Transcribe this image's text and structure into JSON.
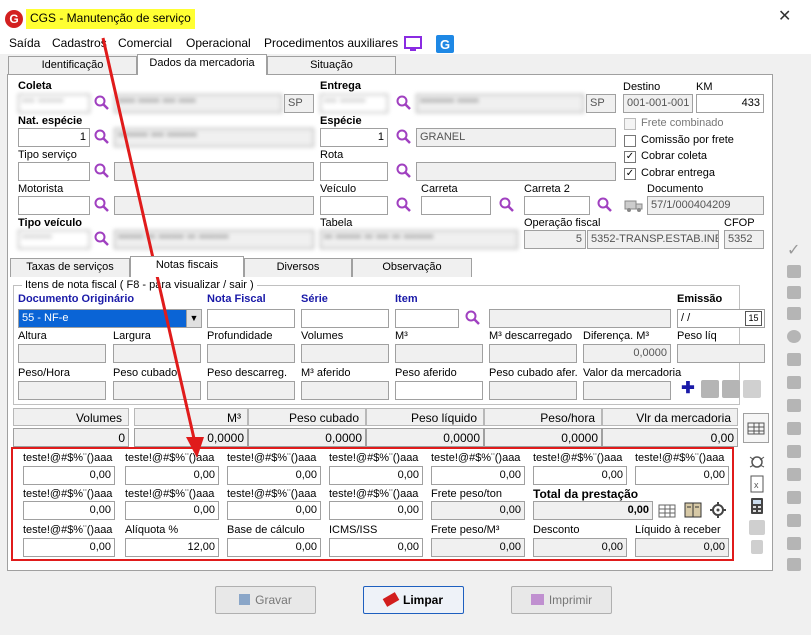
{
  "window": {
    "title": "CGS - Manutenção de serviço",
    "close": "✕"
  },
  "menu": [
    "Saída",
    "Cadastros",
    "Comercial",
    "Operacional",
    "Procedimentos auxiliares"
  ],
  "tabs_top": [
    "Identificação",
    "Dados da mercadoria",
    "Situação"
  ],
  "coleta": {
    "label": "Coleta",
    "code": "*** ******",
    "name": "**** ***** *** ****",
    "uf": "SP"
  },
  "entrega": {
    "label": "Entrega",
    "code": "*** ******",
    "name": "******** *****",
    "uf": "SP"
  },
  "destino": {
    "label": "Destino",
    "value": "001-001-001"
  },
  "km": {
    "label": "KM",
    "value": "433"
  },
  "nat_especie": {
    "label": "Nat. espécie",
    "code": "1",
    "name": "******* *** *******"
  },
  "especie": {
    "label": "Espécie",
    "code": "1",
    "name": "GRANEL"
  },
  "tipo_servico": {
    "label": "Tipo serviço"
  },
  "rota": {
    "label": "Rota"
  },
  "checks": [
    {
      "label": "Frete combinado",
      "checked": false,
      "disabled": true
    },
    {
      "label": "Comissão por frete",
      "checked": false,
      "disabled": false
    },
    {
      "label": "Cobrar coleta",
      "checked": true,
      "disabled": false
    },
    {
      "label": "Cobrar entrega",
      "checked": true,
      "disabled": false
    }
  ],
  "motorista": {
    "label": "Motorista"
  },
  "veiculo": {
    "label": "Veículo"
  },
  "carreta": {
    "label": "Carreta"
  },
  "carreta2": {
    "label": "Carreta 2"
  },
  "documento": {
    "label": "Documento",
    "value": "57/1/000404209"
  },
  "tipo_veiculo": {
    "label": "Tipo veículo",
    "code": "*******",
    "name": "****** ** ****** ** *******"
  },
  "tabela": {
    "label": "Tabela",
    "value": "** ****** ** *** ** *******"
  },
  "operacao_fiscal": {
    "label": "Operação fiscal",
    "code": "5",
    "name": "5352-TRANSP.ESTAB.INE"
  },
  "cfop": {
    "label": "CFOP",
    "value": "5352"
  },
  "tabs_mid": [
    "Taxas de serviços",
    "Notas fiscais",
    "Diversos",
    "Observação"
  ],
  "group_title": "Itens de nota fiscal ( F8 - para visualizar / sair )",
  "nf_row1": {
    "doc_label": "Documento Originário",
    "doc_value": "55 - NF-e",
    "nota": "Nota Fiscal",
    "serie": "Série",
    "item": "Item",
    "emissao": "Emissão",
    "emissao_value": "/ /",
    "cal": "15"
  },
  "nf_row2": [
    "Altura",
    "Largura",
    "Profundidade",
    "Volumes",
    "M³",
    "M³ descarregado",
    "Diferença. M³",
    "Peso líq"
  ],
  "dif_m3_value": "0,0000",
  "nf_row3": [
    "Peso/Hora",
    "Peso cubado",
    "Peso descarreg.",
    "M³ aferido",
    "Peso aferido",
    "Peso cubado afer.",
    "Valor da mercadoria"
  ],
  "totals": {
    "headers": [
      "Volumes",
      "M³",
      "Peso cubado",
      "Peso líquido",
      "Peso/hora",
      "Vlr da mercadoria"
    ],
    "values": [
      "0",
      "0,0000",
      "0,0000",
      "0,0000",
      "0,0000",
      "0,00"
    ]
  },
  "fees_row1": [
    {
      "label": "teste!@#$%¨()aaa",
      "value": "0,00"
    },
    {
      "label": "teste!@#$%¨()aaa",
      "value": "0,00"
    },
    {
      "label": "teste!@#$%¨()aaa",
      "value": "0,00"
    },
    {
      "label": "teste!@#$%¨()aaa",
      "value": "0,00"
    },
    {
      "label": "teste!@#$%¨()aaa",
      "value": "0,00"
    },
    {
      "label": "teste!@#$%¨()aaa",
      "value": "0,00"
    },
    {
      "label": "teste!@#$%¨()aaa",
      "value": "0,00"
    }
  ],
  "fees_row2": [
    {
      "label": "teste!@#$%¨()aaa",
      "value": "0,00"
    },
    {
      "label": "teste!@#$%¨()aaa",
      "value": "0,00"
    },
    {
      "label": "teste!@#$%¨()aaa",
      "value": "0,00"
    },
    {
      "label": "teste!@#$%¨()aaa",
      "value": "0,00"
    },
    {
      "label": "Frete peso/ton",
      "value": "0,00"
    }
  ],
  "total_prestacao": {
    "label": "Total da prestação",
    "value": "0,00"
  },
  "fees_row3": [
    {
      "label": "teste!@#$%¨()aaa",
      "value": "0,00"
    },
    {
      "label": "Alíquota %",
      "value": "12,00"
    },
    {
      "label": "Base de cálculo",
      "value": "0,00"
    },
    {
      "label": "ICMS/ISS",
      "value": "0,00"
    },
    {
      "label": "Frete peso/M³",
      "value": "0,00"
    },
    {
      "label": "Desconto",
      "value": "0,00"
    },
    {
      "label": "Líquido à receber",
      "value": "0,00"
    }
  ],
  "buttons": {
    "gravar": "Gravar",
    "limpar": "Limpar",
    "imprimir": "Imprimir"
  },
  "colors": {
    "highlight": "#ffff33",
    "annotation": "#e01b1b",
    "selection": "#0a64d6"
  }
}
